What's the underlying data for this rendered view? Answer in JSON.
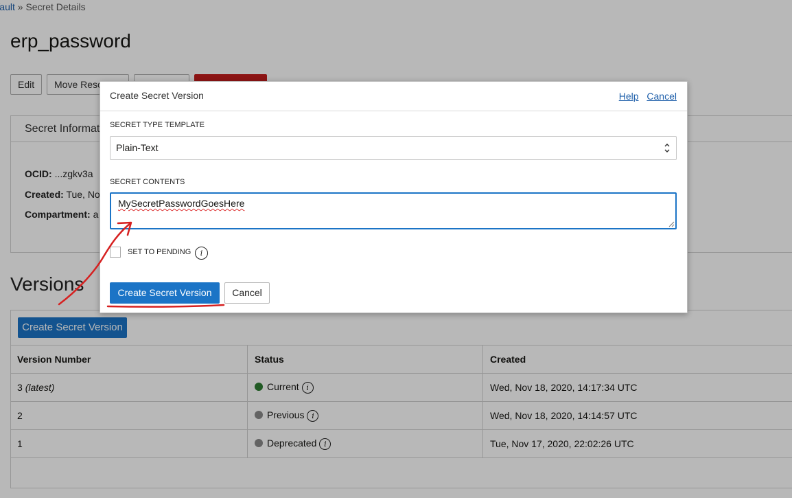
{
  "breadcrumb": {
    "link": "Vault",
    "separator": "»",
    "current": "Secret Details"
  },
  "page_title": "erp_password",
  "actions": {
    "edit": "Edit",
    "move": "Move Resource"
  },
  "info": {
    "header": "Secret Information",
    "ocid_label": "OCID:",
    "ocid_value": "...zgkv3a",
    "created_label": "Created:",
    "created_value": "Tue, No",
    "compartment_label": "Compartment:",
    "compartment_value": "a"
  },
  "versions": {
    "heading": "Versions",
    "create_button": "Create Secret Version",
    "columns": [
      "Version Number",
      "Status",
      "Created"
    ],
    "rows": [
      {
        "number": "3",
        "suffix": "(latest)",
        "status": "Current",
        "status_color": "#2e7d32",
        "created": "Wed, Nov 18, 2020, 14:17:34 UTC"
      },
      {
        "number": "2",
        "suffix": "",
        "status": "Previous",
        "status_color": "#8a8a8a",
        "created": "Wed, Nov 18, 2020, 14:14:57 UTC"
      },
      {
        "number": "1",
        "suffix": "",
        "status": "Deprecated",
        "status_color": "#8a8a8a",
        "created": "Tue, Nov 17, 2020, 22:02:26 UTC"
      }
    ]
  },
  "modal": {
    "title": "Create Secret Version",
    "help": "Help",
    "cancel_link": "Cancel",
    "type_label": "SECRET TYPE TEMPLATE",
    "type_value": "Plain-Text",
    "contents_label": "SECRET CONTENTS",
    "contents_value": "MySecretPasswordGoesHere",
    "pending_label": "SET TO PENDING",
    "pending_checked": false,
    "submit": "Create Secret Version",
    "cancel": "Cancel"
  },
  "icons": {
    "info": "i",
    "select_chevron": "⌃⌄"
  },
  "colors": {
    "primary": "#1b74c6",
    "danger": "#c21d1d",
    "annotation": "#d62020"
  }
}
